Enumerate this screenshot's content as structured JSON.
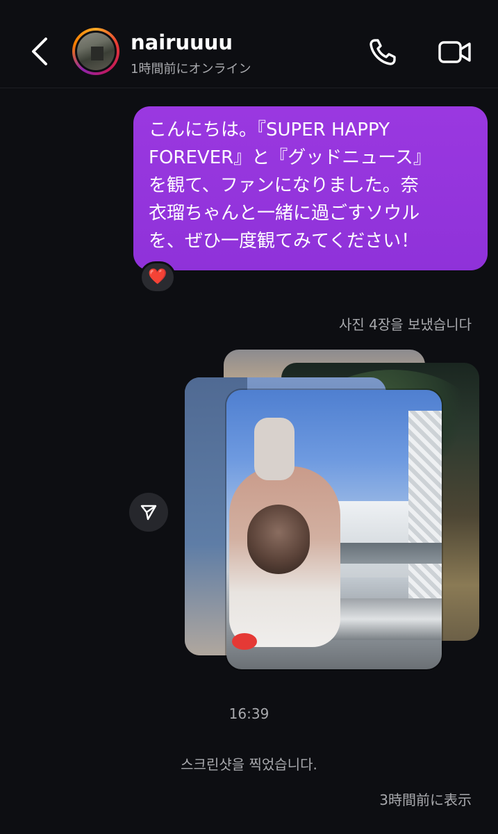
{
  "header": {
    "back_icon": "chevron-left-icon",
    "username": "nairuuuu",
    "status": "1時間前にオンライン",
    "call_icon": "phone-icon",
    "video_icon": "video-camera-icon"
  },
  "messages": {
    "outgoing_text": "こんにちは。『SUPER HAPPY\nFOREVER』と『グッドニュース』\nを観て、ファンになりました。奈\n衣瑠ちゃんと一緒に過ごすソウル\nを、ぜひ一度観てみてください！",
    "reaction": "❤️",
    "photos_note": "사진 4장을 보냈습니다",
    "photo_count": 4,
    "share_icon": "share-paper-plane-icon",
    "time": "16:39",
    "screenshot_note": "스크린샷을 찍었습니다.",
    "seen": "3時間前に表示"
  },
  "colors": {
    "background": "#0d0e12",
    "bubble": "#9a38e0",
    "secondary_text": "#a8a9ad"
  }
}
